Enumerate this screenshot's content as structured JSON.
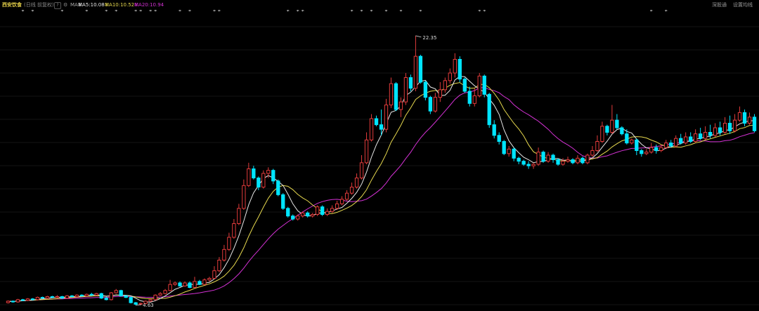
{
  "header": {
    "stock_name": "西安饮食",
    "period_label": "(日线 前复权)",
    "help_glyph": "?",
    "settings_glyph": "⚙",
    "ma_label": "MA",
    "ma5_label": "MA5:10.08",
    "ma5_arrow": "↓",
    "ma10_label": "MA10:10.52",
    "ma10_arrow": "↓",
    "ma20_label": "MA20:10.94",
    "ma20_arrow": "↓",
    "right_btn1": "深股通",
    "right_btn2": "设置均线"
  },
  "chart_data": {
    "type": "candlestick",
    "title": "",
    "annotations": [
      {
        "text": "22.35",
        "label": "high"
      },
      {
        "text": "4.63",
        "label": "low"
      }
    ],
    "up_color": "#e23b3b",
    "down_color": "#00e5ff",
    "ma_colors": {
      "MA5": "#e8e8e8",
      "MA10": "#e6d84e",
      "MA20": "#d431d4"
    },
    "ylim": [
      4.3,
      23.5
    ],
    "event_markers": [
      3,
      5,
      11,
      16,
      20,
      22,
      26,
      27,
      29,
      30,
      35,
      37,
      42,
      43,
      57,
      59,
      60,
      70,
      72,
      74,
      77,
      80,
      84,
      96,
      97,
      131,
      134
    ],
    "candles": [
      [
        4.8,
        4.9,
        4.75,
        4.95
      ],
      [
        4.9,
        4.85,
        4.8,
        4.95
      ],
      [
        4.85,
        5.0,
        4.8,
        5.05
      ],
      [
        5.0,
        4.95,
        4.9,
        5.05
      ],
      [
        4.95,
        5.05,
        4.9,
        5.1
      ],
      [
        5.05,
        5.0,
        4.95,
        5.1
      ],
      [
        5.0,
        5.15,
        4.95,
        5.2
      ],
      [
        5.15,
        5.1,
        5.05,
        5.2
      ],
      [
        5.1,
        5.2,
        5.05,
        5.25
      ],
      [
        5.2,
        5.15,
        5.1,
        5.25
      ],
      [
        5.15,
        5.2,
        5.1,
        5.3
      ],
      [
        5.2,
        5.1,
        5.05,
        5.25
      ],
      [
        5.1,
        5.25,
        5.05,
        5.3
      ],
      [
        5.25,
        5.2,
        5.15,
        5.3
      ],
      [
        5.2,
        5.3,
        5.15,
        5.35
      ],
      [
        5.3,
        5.25,
        5.2,
        5.35
      ],
      [
        5.25,
        5.35,
        5.2,
        5.4
      ],
      [
        5.35,
        5.3,
        5.25,
        5.45
      ],
      [
        5.3,
        5.4,
        5.25,
        5.45
      ],
      [
        5.4,
        5.1,
        5.05,
        5.45
      ],
      [
        5.1,
        5.0,
        4.95,
        5.2
      ],
      [
        5.0,
        5.45,
        4.95,
        5.5
      ],
      [
        5.45,
        5.6,
        5.4,
        5.7
      ],
      [
        5.6,
        5.25,
        5.2,
        5.65
      ],
      [
        5.25,
        5.15,
        5.1,
        5.3
      ],
      [
        5.15,
        4.8,
        4.75,
        5.2
      ],
      [
        4.8,
        4.7,
        4.63,
        4.85
      ],
      [
        4.7,
        4.75,
        4.63,
        4.8
      ],
      [
        4.75,
        4.9,
        4.7,
        4.95
      ],
      [
        4.9,
        5.0,
        4.85,
        5.05
      ],
      [
        5.0,
        5.3,
        4.95,
        5.35
      ],
      [
        5.3,
        5.4,
        5.25,
        5.5
      ],
      [
        5.4,
        5.6,
        5.35,
        5.7
      ],
      [
        5.6,
        6.0,
        5.55,
        6.3
      ],
      [
        6.0,
        6.1,
        5.9,
        6.2
      ],
      [
        6.1,
        5.9,
        5.85,
        6.2
      ],
      [
        5.9,
        6.1,
        5.85,
        6.2
      ],
      [
        6.1,
        5.8,
        5.75,
        6.2
      ],
      [
        5.8,
        6.2,
        5.75,
        6.5
      ],
      [
        6.2,
        6.0,
        5.95,
        6.3
      ],
      [
        6.0,
        6.3,
        5.95,
        6.4
      ],
      [
        6.3,
        6.4,
        6.2,
        6.5
      ],
      [
        6.4,
        6.9,
        6.35,
        7.2
      ],
      [
        6.9,
        7.6,
        6.8,
        7.8
      ],
      [
        7.6,
        8.3,
        7.5,
        8.6
      ],
      [
        8.3,
        9.1,
        8.2,
        9.4
      ],
      [
        9.1,
        10.0,
        9.0,
        10.3
      ],
      [
        10.0,
        11.0,
        9.9,
        11.3
      ],
      [
        11.0,
        12.5,
        10.9,
        12.9
      ],
      [
        12.5,
        13.6,
        12.4,
        14.0
      ],
      [
        13.6,
        13.0,
        12.9,
        13.8
      ],
      [
        13.0,
        12.4,
        12.2,
        13.1
      ],
      [
        12.4,
        13.3,
        12.3,
        13.5
      ],
      [
        13.3,
        13.5,
        13.0,
        13.7
      ],
      [
        13.5,
        12.8,
        12.6,
        13.6
      ],
      [
        12.8,
        11.9,
        11.8,
        12.9
      ],
      [
        11.9,
        11.0,
        10.9,
        12.0
      ],
      [
        11.0,
        10.5,
        10.4,
        11.1
      ],
      [
        10.5,
        10.3,
        10.2,
        10.6
      ],
      [
        10.3,
        10.5,
        10.2,
        10.6
      ],
      [
        10.5,
        10.7,
        10.4,
        10.8
      ],
      [
        10.7,
        10.5,
        10.4,
        10.8
      ],
      [
        10.5,
        10.6,
        10.4,
        10.7
      ],
      [
        10.6,
        11.1,
        10.5,
        11.2
      ],
      [
        11.1,
        10.6,
        10.5,
        11.2
      ],
      [
        10.6,
        10.8,
        10.5,
        11.0
      ],
      [
        10.8,
        11.0,
        10.7,
        11.2
      ],
      [
        11.0,
        11.3,
        10.9,
        11.5
      ],
      [
        11.3,
        11.6,
        11.2,
        11.8
      ],
      [
        11.6,
        12.0,
        11.5,
        12.2
      ],
      [
        12.0,
        12.4,
        11.9,
        12.7
      ],
      [
        12.4,
        13.0,
        12.3,
        13.3
      ],
      [
        13.0,
        14.0,
        12.9,
        14.5
      ],
      [
        14.0,
        15.5,
        13.9,
        16.0
      ],
      [
        15.5,
        16.9,
        15.4,
        17.2
      ],
      [
        16.9,
        16.5,
        16.4,
        17.1
      ],
      [
        16.5,
        16.2,
        15.8,
        17.5
      ],
      [
        16.2,
        17.8,
        16.0,
        18.2
      ],
      [
        17.8,
        19.2,
        17.6,
        19.6
      ],
      [
        19.2,
        17.5,
        17.4,
        19.3
      ],
      [
        17.5,
        18.0,
        17.0,
        18.3
      ],
      [
        18.0,
        19.6,
        17.8,
        19.9
      ],
      [
        19.6,
        18.9,
        18.7,
        19.8
      ],
      [
        18.9,
        21.0,
        18.7,
        22.35
      ],
      [
        21.0,
        19.3,
        19.2,
        21.1
      ],
      [
        19.3,
        18.3,
        18.1,
        19.4
      ],
      [
        18.3,
        17.4,
        17.2,
        18.4
      ],
      [
        17.4,
        18.3,
        17.3,
        18.6
      ],
      [
        18.3,
        18.8,
        18.0,
        19.3
      ],
      [
        18.8,
        19.4,
        18.6,
        19.6
      ],
      [
        19.4,
        19.9,
        19.2,
        20.2
      ],
      [
        19.9,
        20.8,
        19.6,
        21.2
      ],
      [
        20.8,
        19.5,
        19.3,
        21.0
      ],
      [
        19.5,
        18.7,
        18.6,
        19.6
      ],
      [
        18.7,
        17.9,
        17.7,
        19.0
      ],
      [
        17.9,
        18.4,
        17.7,
        18.9
      ],
      [
        18.4,
        19.7,
        18.3,
        19.9
      ],
      [
        19.7,
        18.5,
        18.3,
        19.8
      ],
      [
        18.5,
        16.5,
        16.3,
        18.6
      ],
      [
        16.5,
        15.8,
        15.6,
        16.8
      ],
      [
        15.8,
        15.4,
        15.2,
        16.0
      ],
      [
        15.4,
        14.6,
        14.5,
        15.5
      ],
      [
        14.6,
        14.9,
        14.4,
        15.1
      ],
      [
        14.9,
        14.3,
        14.1,
        15.0
      ],
      [
        14.3,
        14.1,
        13.9,
        14.4
      ],
      [
        14.1,
        13.9,
        13.8,
        14.2
      ],
      [
        13.9,
        13.8,
        13.6,
        14.1
      ],
      [
        13.8,
        13.9,
        13.6,
        14.0
      ],
      [
        13.9,
        14.7,
        13.8,
        15.0
      ],
      [
        14.7,
        14.1,
        14.0,
        14.8
      ],
      [
        14.1,
        14.5,
        14.0,
        14.7
      ],
      [
        14.5,
        14.2,
        14.0,
        14.6
      ],
      [
        14.2,
        13.9,
        13.8,
        14.3
      ],
      [
        13.9,
        14.1,
        13.8,
        14.3
      ],
      [
        14.1,
        14.2,
        14.0,
        14.4
      ],
      [
        14.2,
        14.0,
        13.9,
        14.3
      ],
      [
        14.0,
        14.3,
        13.9,
        14.5
      ],
      [
        14.3,
        14.0,
        13.9,
        14.4
      ],
      [
        14.0,
        14.5,
        13.9,
        14.6
      ],
      [
        14.5,
        14.8,
        14.4,
        15.1
      ],
      [
        14.8,
        15.4,
        14.7,
        15.8
      ],
      [
        15.4,
        16.4,
        15.3,
        16.7
      ],
      [
        16.4,
        16.0,
        15.8,
        16.5
      ],
      [
        16.0,
        16.8,
        15.9,
        17.8
      ],
      [
        16.8,
        16.3,
        16.2,
        17.2
      ],
      [
        16.3,
        15.9,
        15.8,
        16.4
      ],
      [
        15.9,
        15.3,
        15.2,
        16.2
      ],
      [
        15.3,
        15.5,
        15.2,
        15.6
      ],
      [
        15.5,
        14.8,
        14.5,
        15.6
      ],
      [
        14.8,
        14.6,
        14.4,
        14.9
      ],
      [
        14.6,
        14.7,
        14.5,
        14.9
      ],
      [
        14.7,
        15.0,
        14.6,
        15.3
      ],
      [
        15.0,
        14.8,
        14.6,
        15.2
      ],
      [
        14.8,
        15.0,
        14.7,
        15.2
      ],
      [
        15.0,
        15.3,
        14.9,
        15.5
      ],
      [
        15.3,
        15.1,
        15.0,
        15.5
      ],
      [
        15.1,
        15.6,
        15.0,
        15.8
      ],
      [
        15.6,
        15.3,
        15.2,
        15.9
      ],
      [
        15.3,
        15.7,
        15.2,
        16.0
      ],
      [
        15.7,
        15.4,
        15.3,
        16.0
      ],
      [
        15.4,
        15.9,
        15.3,
        16.2
      ],
      [
        15.9,
        15.6,
        15.5,
        16.3
      ],
      [
        15.6,
        16.0,
        15.5,
        16.4
      ],
      [
        16.0,
        15.8,
        15.6,
        16.5
      ],
      [
        15.8,
        16.3,
        15.7,
        16.6
      ],
      [
        16.3,
        16.0,
        15.8,
        16.7
      ],
      [
        16.0,
        16.6,
        15.9,
        17.0
      ],
      [
        16.6,
        16.1,
        15.9,
        17.1
      ],
      [
        16.1,
        16.8,
        16.0,
        17.2
      ],
      [
        16.8,
        17.3,
        16.7,
        17.7
      ],
      [
        17.3,
        16.6,
        16.4,
        17.5
      ],
      [
        16.6,
        17.0,
        16.5,
        17.3
      ],
      [
        17.0,
        16.1,
        16.0,
        17.2
      ]
    ]
  }
}
